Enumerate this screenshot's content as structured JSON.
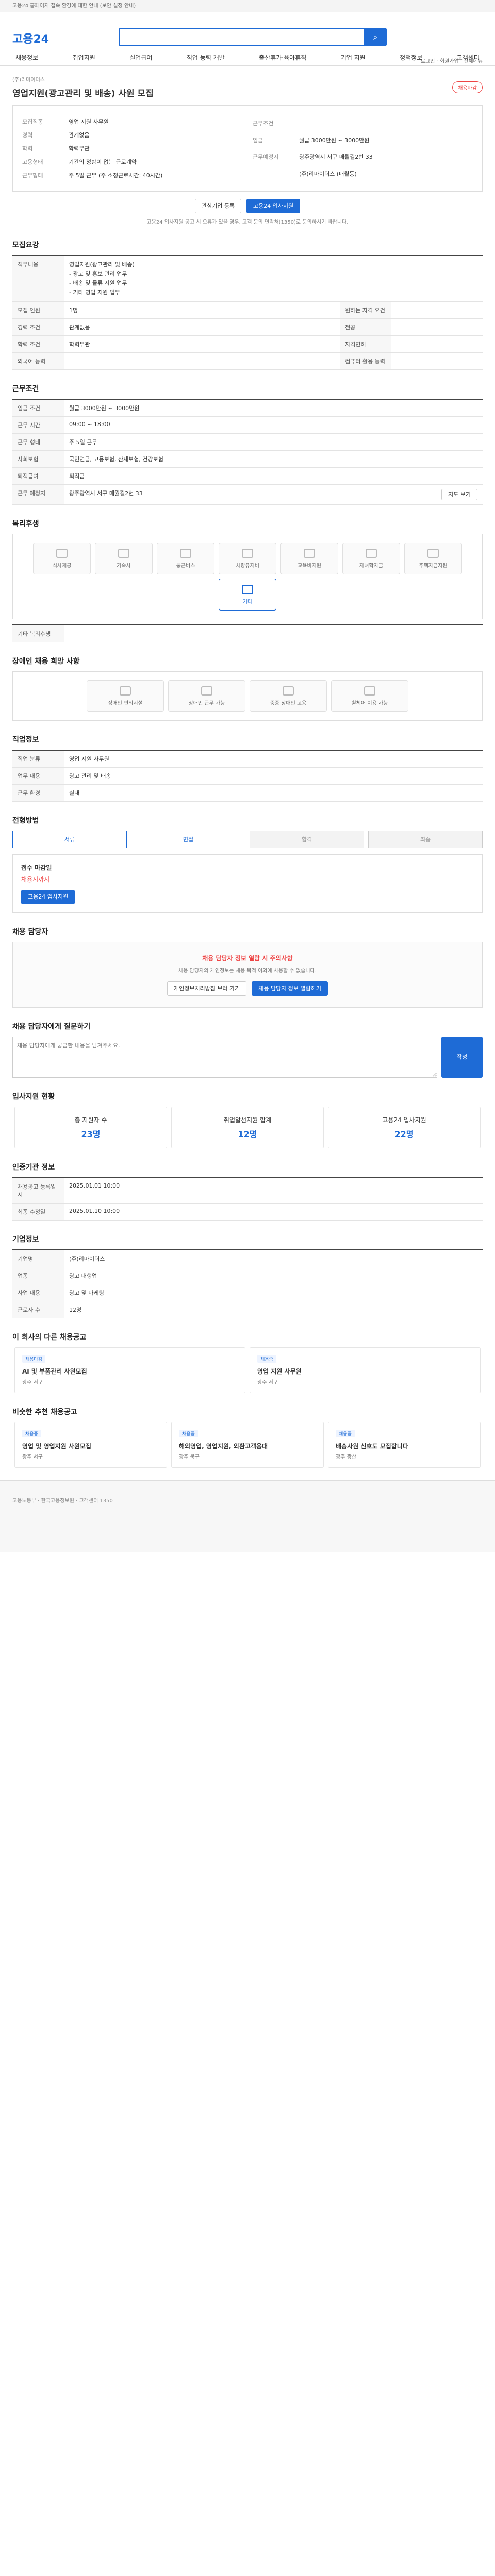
{
  "topbar": {
    "notice": "고용24 홈페이지 접속 환경에 대한 안내 (보안 설정 안내)"
  },
  "header": {
    "logo_a": "고용",
    "logo_b": "24",
    "toplinks": "로그인 · 회원가입 · 전체메뉴"
  },
  "gnb": [
    "채용정보",
    "취업지원",
    "실업급여",
    "직업 능력 개발",
    "출산휴가·육아휴직",
    "기업 지원",
    "정책정보",
    "고객센터"
  ],
  "job": {
    "company": "(주)리마이더스",
    "status": "채용마감",
    "title": "영업지원(광고관리 및 배송) 사원 모집",
    "left_rows": [
      [
        "모집직종",
        "영업 지원 사무원"
      ],
      [
        "경력",
        "관계없음"
      ],
      [
        "학력",
        "학력무관"
      ],
      [
        "고용형태",
        "기간의 정함이 없는 근로계약"
      ],
      [
        "근무형태",
        "주 5일 근무 (주 소정근로시간: 40시간)"
      ]
    ],
    "right_rows": [
      [
        "근무조건",
        ""
      ],
      [
        "임금",
        "월급 3000만원 ~ 3000만원"
      ],
      [
        "근무예정지",
        "광주광역시 서구 매월길2번 33"
      ],
      [
        "",
        "(주)리마이더스 (매월동)"
      ]
    ],
    "actions": {
      "interest": "관심기업 등록",
      "apply": "고용24 입사지원"
    },
    "disclaimer": "고용24 입사지원 공고 시 오류가 있을 경우, 고객 문의 연락처(1350)로 문의하시기 바랍니다."
  },
  "recruit": {
    "title": "모집요강",
    "duty_label": "직무내용",
    "duty_text": [
      "영업지원(광고관리 및 배송)",
      "- 광고 및 홍보 관리 업무",
      "- 배송 및 물류 지원 업무",
      "- 기타 영업 지원 업무"
    ],
    "rows": [
      [
        "모집 인원",
        "1명",
        "원하는 자격 요건",
        ""
      ],
      [
        "경력 조건",
        "관계없음",
        "전공",
        ""
      ],
      [
        "학력 조건",
        "학력무관",
        "자격면허",
        ""
      ],
      [
        "외국어 능력",
        "",
        "컴퓨터 활용 능력",
        ""
      ]
    ],
    "salary_rows": [
      [
        "임금 조건",
        "월급 3000만원 ~ 3000만원"
      ],
      [
        "근무 시간",
        "09:00 ~ 18:00"
      ],
      [
        "근무 형태",
        "주 5일 근무"
      ],
      [
        "사회보험",
        "국민연금, 고용보험, 산재보험, 건강보험"
      ],
      [
        "퇴직급여",
        "퇴직금"
      ]
    ]
  },
  "conditions": {
    "title": "근무조건",
    "address_label": "근무 예정지",
    "address": "광주광역시 서구 매월길2번 33",
    "map_btn": "지도 보기"
  },
  "welfare": {
    "title": "복리후생",
    "items": [
      "식사제공",
      "기숙사",
      "통근버스",
      "차량유지비",
      "교육비지원",
      "자녀학자금",
      "주택자금지원",
      "기타"
    ],
    "extra_label": "기타 복리후생"
  },
  "disabled": {
    "title": "장애인 채용 희망 사항",
    "items": [
      "장애인 편의시설",
      "장애인 근무 가능",
      "중증 장애인 고용",
      "휠체어 이용 가능"
    ]
  },
  "job_info": {
    "title": "직업정보",
    "rows": [
      [
        "직업 분류",
        "영업 지원 사무원"
      ],
      [
        "업무 내용",
        "광고 관리 및 배송"
      ],
      [
        "근무 환경",
        "실내"
      ]
    ]
  },
  "process": {
    "title": "전형방법",
    "steps": [
      "서류",
      "면접",
      "합격",
      "최종"
    ],
    "contact_title": "접수 마감일",
    "contact_label": "채용시까지",
    "apply_method": "고용24 입사지원"
  },
  "manager": {
    "title": "채용 담당자",
    "notice": "채용 담당자 정보 열람 시 주의사항",
    "desc": "채용 담당자의 개인정보는 채용 목적 이외에 사용할 수 없습니다.",
    "btn_a": "개인정보처리방침 보러 가기",
    "btn_b": "채용 담당자 정보 열람하기"
  },
  "qna": {
    "title": "채용 담당자에게 질문하기",
    "placeholder": "채용 담당자에게 궁금한 내용을 남겨주세요.",
    "submit": "작성"
  },
  "stats": {
    "title": "입사지원 현황",
    "items": [
      [
        "총 지원자 수",
        "23명"
      ],
      [
        "취업알선지원 합계",
        "12명"
      ],
      [
        "고용24 입사지원",
        "22명"
      ]
    ]
  },
  "cert": {
    "title": "인증기관 정보",
    "rows": [
      [
        "채용공고 등록일시",
        "2025.01.01 10:00"
      ],
      [
        "최종 수정일",
        "2025.01.10 10:00"
      ]
    ]
  },
  "company_info": {
    "title": "기업정보",
    "rows": [
      [
        "기업명",
        "(주)리마이더스"
      ],
      [
        "업종",
        "광고 대행업"
      ],
      [
        "사업 내용",
        "광고 및 마케팅"
      ],
      [
        "근로자 수",
        "12명"
      ]
    ]
  },
  "related": {
    "title": "이 회사의 다른 채용공고",
    "cards": [
      [
        "채용마감",
        "AI 및 부품관리 사원모집",
        "광주 서구"
      ],
      [
        "채용중",
        "영업 지원 사무원",
        "광주 서구"
      ]
    ]
  },
  "similar": {
    "title": "비슷한 추천 채용공고",
    "cards": [
      [
        "채용중",
        "영업 및 영업지원 사원모집",
        "광주 서구"
      ],
      [
        "채용중",
        "해외영업, 영업지원, 외환고객응대",
        "광주 북구"
      ],
      [
        "채용중",
        "배송사원 신호도 모집합니다",
        "광주 광산"
      ]
    ]
  },
  "footer": {
    "text": "고용노동부 · 한국고용정보원 · 고객센터 1350"
  }
}
